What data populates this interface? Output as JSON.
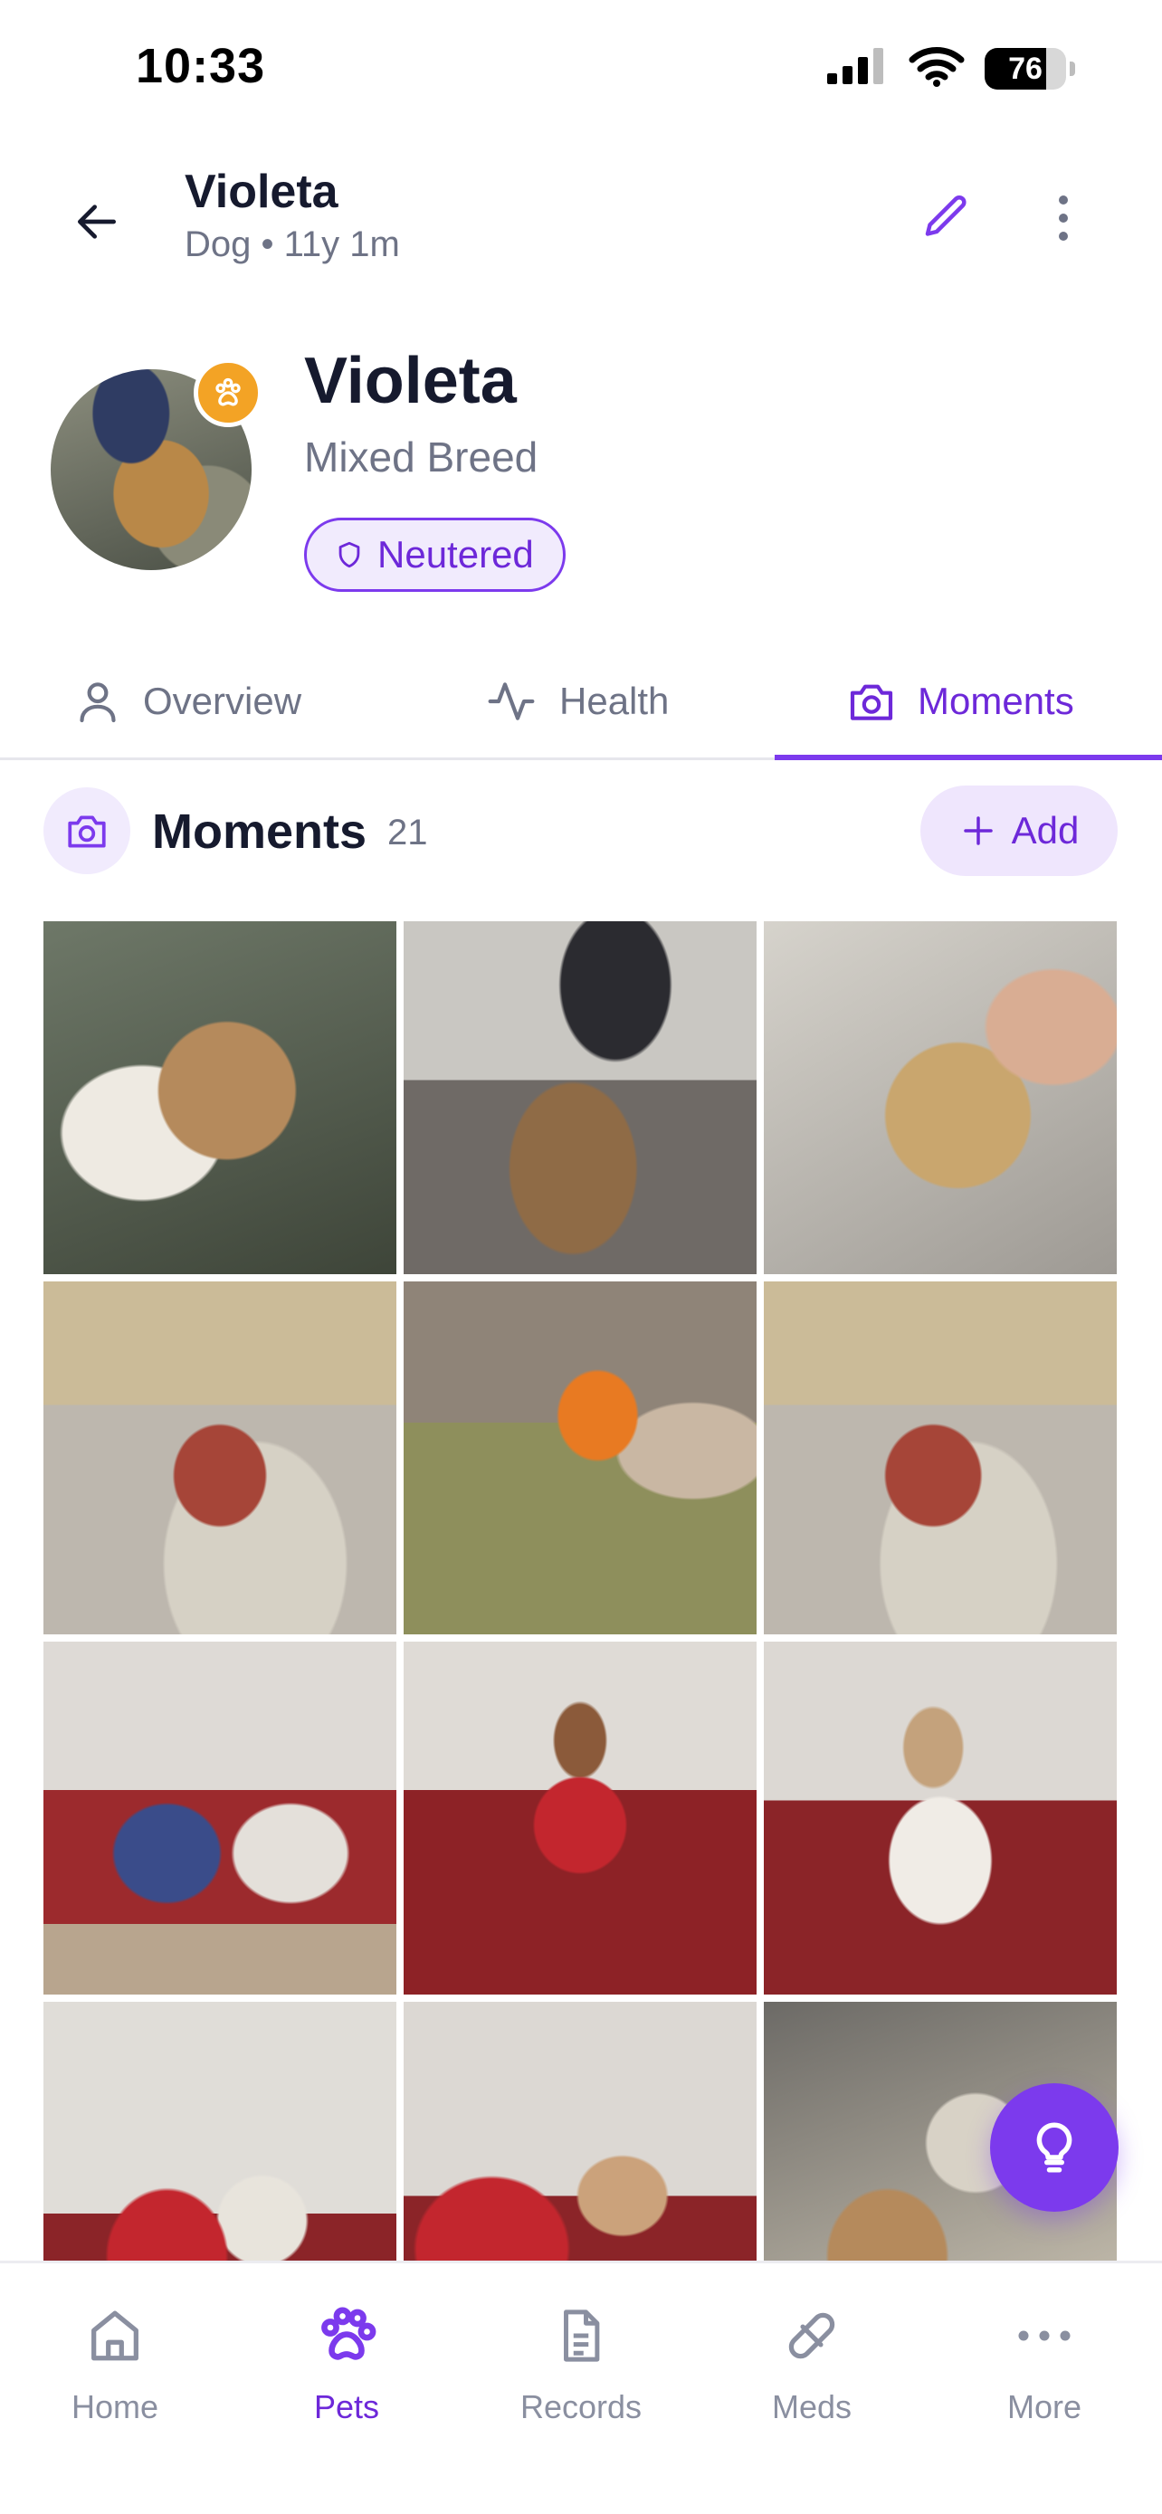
{
  "status_bar": {
    "time": "10:33",
    "battery": "76",
    "battery_level": 0.76
  },
  "header": {
    "name": "Violeta",
    "subtitle": "Dog • 11y 1m"
  },
  "profile": {
    "name": "Violeta",
    "breed": "Mixed Breed",
    "status_badge": "Neutered"
  },
  "tabs": [
    {
      "label": "Overview",
      "icon": "person-icon",
      "active": false
    },
    {
      "label": "Health",
      "icon": "pulse-icon",
      "active": false
    },
    {
      "label": "Moments",
      "icon": "camera-icon",
      "active": true
    }
  ],
  "moments": {
    "title": "Moments",
    "count": "21",
    "add_label": "Add"
  },
  "photos": [
    "dog-under-blanket",
    "dog-on-couch-with-man-at-desk",
    "dog-cuddling-with-man",
    "dog-in-sweater-on-sofa",
    "couple-outdoors-with-dog",
    "dog-in-sweater-on-sofa",
    "man-relaxing-with-dog",
    "woman-with-dog-and-cat",
    "dog-in-pajamas",
    "woman-with-dog-on-couch",
    "woman-looking-at-dog",
    "dog-in-car"
  ],
  "bottom_nav": [
    {
      "label": "Home",
      "icon": "home-icon",
      "active": false
    },
    {
      "label": "Pets",
      "icon": "paw-icon",
      "active": true
    },
    {
      "label": "Records",
      "icon": "document-icon",
      "active": false
    },
    {
      "label": "Meds",
      "icon": "pill-icon",
      "active": false
    },
    {
      "label": "More",
      "icon": "ellipsis-icon",
      "active": false
    }
  ],
  "colors": {
    "accent": "#7c3aed",
    "accent_light": "#f1ebfd",
    "badge_orange": "#f3a325",
    "text_primary": "#161a2e",
    "text_secondary": "#6e7386"
  }
}
